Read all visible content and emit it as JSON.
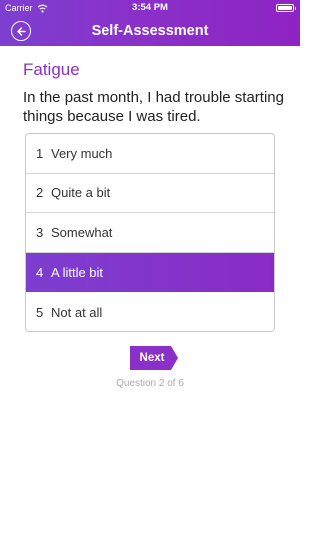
{
  "status_bar": {
    "carrier": "Carrier",
    "time": "3:54 PM",
    "battery_level": 1.0
  },
  "navbar": {
    "title": "Self-Assessment",
    "back_icon": "back-arrow-circle-icon"
  },
  "question": {
    "title": "Fatigue",
    "text": "In the past month, I had trouble starting things because I was tired."
  },
  "options": [
    {
      "number": "1",
      "label": "Very much"
    },
    {
      "number": "2",
      "label": "Quite a bit"
    },
    {
      "number": "3",
      "label": "Somewhat"
    },
    {
      "number": "4",
      "label": "A little bit"
    },
    {
      "number": "5",
      "label": "Not at all"
    }
  ],
  "selected_option": "4",
  "next_label": "Next",
  "progress_text": "Question 2 of 6",
  "colors": {
    "accent": "#8a2fc8",
    "header_gradient_start": "#7e3fd0",
    "header_gradient_end": "#8e24c3"
  }
}
